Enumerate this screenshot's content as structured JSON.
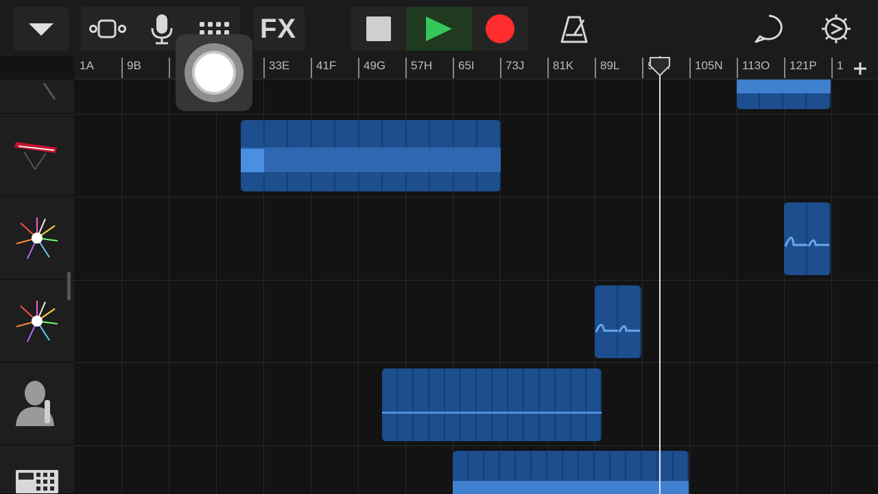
{
  "toolbar": {
    "fx_label": "FX",
    "icons": [
      "dropdown-icon",
      "tracks-view-icon",
      "microphone-icon",
      "grid-view-icon",
      "fx",
      "stop-icon",
      "play-icon",
      "record-icon",
      "metronome-icon",
      "loop-icon",
      "settings-icon"
    ],
    "colors": {
      "play": "#34c759",
      "record": "#ff2d2d"
    }
  },
  "ruler": {
    "labels": [
      "1A",
      "9B",
      "",
      "",
      "33E",
      "41F",
      "49G",
      "57H",
      "65I",
      "73J",
      "81K",
      "89L",
      "97M",
      "105N",
      "113O",
      "121P",
      "1"
    ]
  },
  "tracks": [
    {
      "icon": "drum-machine-icon"
    },
    {
      "icon": "keyboard-icon"
    },
    {
      "icon": "sparkle-instrument-icon"
    },
    {
      "icon": "sparkle-instrument-icon"
    },
    {
      "icon": "vocalist-icon"
    },
    {
      "icon": "beat-sequencer-icon"
    }
  ],
  "accent_color": "#1d4e8e"
}
